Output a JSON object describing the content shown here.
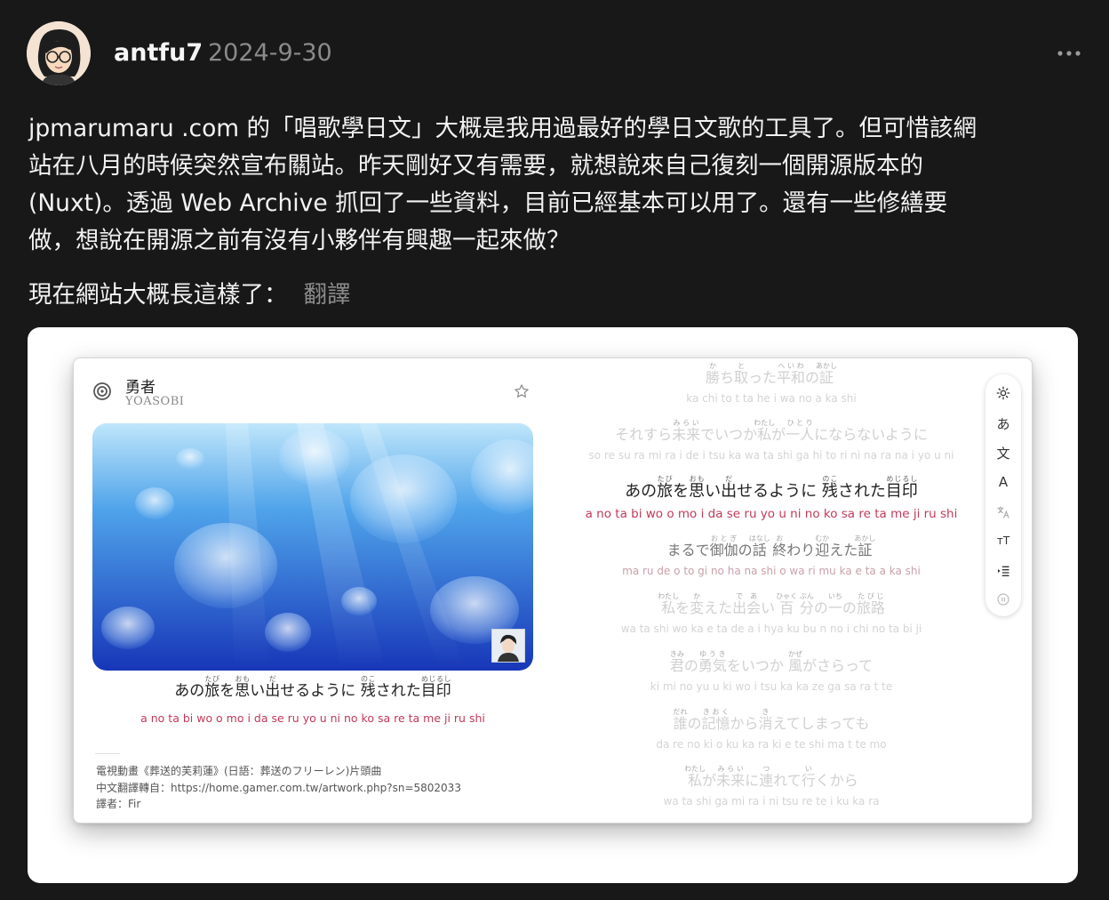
{
  "post": {
    "username": "antfu7",
    "date": "2024-9-30",
    "body_lines": [
      "jpmarumaru .com 的「唱歌學日文」大概是我用過最好的學日文歌的工具了。但可惜該網",
      "站在八月的時候突然宣布關站。昨天剛好又有需要，就想說來自己復刻一個開源版本的",
      "(Nuxt)。透過 Web Archive 抓回了一些資料，目前已經基本可以用了。還有一些修繕要",
      "做，想說在開源之前有沒有小夥伴有興趣一起來做？"
    ],
    "subline": "現在網站大概長這樣了：",
    "translate_label": "翻譯"
  },
  "app": {
    "song_title": "勇者",
    "artist": "YOASOBI",
    "current": {
      "text": "あの旅を思い出せるように 残された目印",
      "romaji": "a no ta bi wo o mo i da se ru yo u ni no ko sa re ta me ji ru shi"
    },
    "credits": [
      "電視動畫《葬送的芙莉蓮》(日語：葬送のフリーレン)片頭曲",
      "中文翻譯轉自：https://home.gamer.com.tw/artwork.php?sn=5802033",
      "譯者：Fir"
    ],
    "lyrics": [
      {
        "jp": "勝ち取った平和の証",
        "ro": "ka chi to t ta he i wa no a ka shi"
      },
      {
        "jp": "それすら未来でいつか私が一人にならないように",
        "ro": "so re su ra mi ra i de i tsu ka wa ta shi ga hi to ri ni na ra na i yo u ni"
      },
      {
        "jp": "あの旅を思い出せるように 残された目印",
        "ro": "a no ta bi wo o mo i da se ru yo u ni no ko sa re ta me ji ru shi"
      },
      {
        "jp": "まるで御伽の話 終わり迎えた証",
        "ro": "ma ru de o to gi no ha na shi o wa ri mu ka e ta a ka shi"
      },
      {
        "jp": "私を変えた出会い 百 分の一の旅路",
        "ro": "wa ta shi wo ka e ta de a i hya ku bu n no i chi no ta bi ji"
      },
      {
        "jp": "君の勇気をいつか 風がさらって",
        "ro": "ki mi no yu u ki wo i tsu ka ka ze ga sa ra t te"
      },
      {
        "jp": "誰の記憶から消えてしまっても",
        "ro": "da re no ki o ku ka ra ki e te shi ma t te mo"
      },
      {
        "jp": "私が未来に連れて行くから",
        "ro": "wa ta shi ga mi ra i ni tsu re te i ku ka ra"
      }
    ],
    "toolbar": {
      "hiragana": "あ",
      "kanji": "文",
      "romaji": "A",
      "font_size": "тT"
    }
  }
}
